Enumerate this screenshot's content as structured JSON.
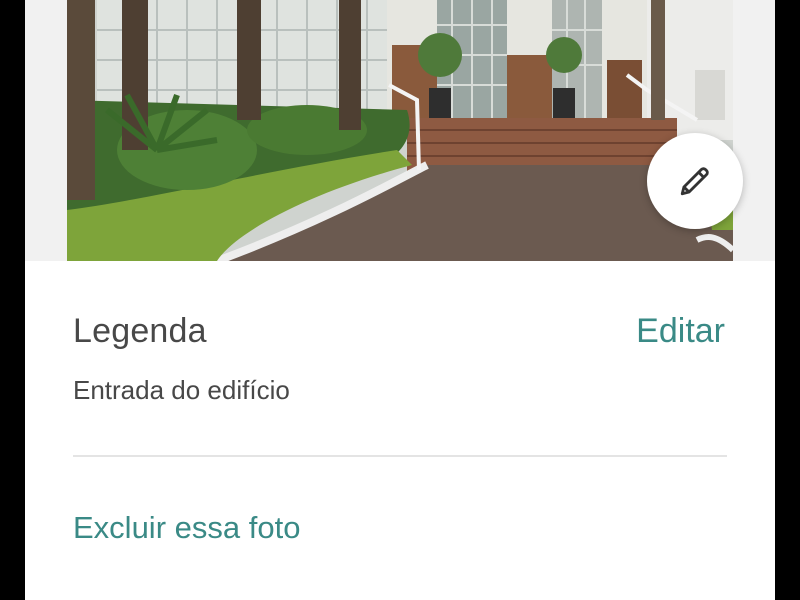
{
  "photo": {
    "description_icon": "building-entrance-photo"
  },
  "edit_button": {
    "icon": "pencil-icon"
  },
  "caption": {
    "title": "Legenda",
    "edit_label": "Editar",
    "text": "Entrada do edifício"
  },
  "actions": {
    "delete_label": "Excluir essa foto"
  },
  "colors": {
    "accent": "#3a8a86",
    "text": "#484848",
    "divider": "#e4e4e4"
  }
}
